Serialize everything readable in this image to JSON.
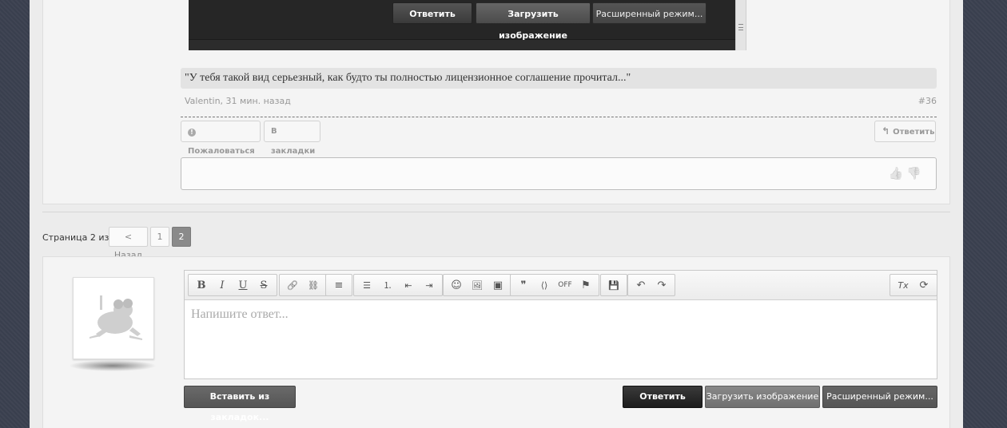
{
  "embedded_screenshot": {
    "reply_label": "Ответить",
    "upload_label": "Загрузить изображение",
    "advanced_label": "Расширенный режим..."
  },
  "post": {
    "quote": "\"У тебя такой вид серьезный, как будто ты полностью лицензионное соглашение прочитал...\"",
    "author_time": "Valentin, 31 мин. назад",
    "number": "#36",
    "complain_label": "Пожаловаться",
    "bookmarks_label": "В закладки",
    "reply_label": "Ответить",
    "complain_icon": "!",
    "reply_icon": "↰",
    "thumbs_up_icon": "👍",
    "thumbs_down_icon": "👎"
  },
  "pagination": {
    "label": "Страница 2 из 2",
    "prev_label": "< Назад",
    "pages": [
      "1",
      "2"
    ],
    "current": "2"
  },
  "reply_form": {
    "placeholder": "Напишите ответ...",
    "insert_bookmarks_label": "Вставить из закладок...",
    "send_label": "Ответить",
    "upload_label": "Загрузить изображение",
    "advanced_label": "Расширенный режим...",
    "toolbar": {
      "bold": "B",
      "italic": "I",
      "underline": "U",
      "strike": "S",
      "link": "🔗",
      "unlink": "⛓",
      "align": "≡",
      "bullets": "☰",
      "numbered": "⒈",
      "outdent": "⇤",
      "indent": "⇥",
      "smilies": "☺",
      "image": "🖼",
      "media": "▣",
      "quote": "❞",
      "code": "⟨⟩",
      "off": "OFF",
      "flag": "⚑",
      "save": "💾",
      "undo": "↶",
      "redo": "↷",
      "remove_format": "Tx",
      "restore": "⟳"
    }
  },
  "colors": {
    "background": "#3b4150",
    "card": "#f4f4f4",
    "primary_button": "#1c1c1c"
  }
}
